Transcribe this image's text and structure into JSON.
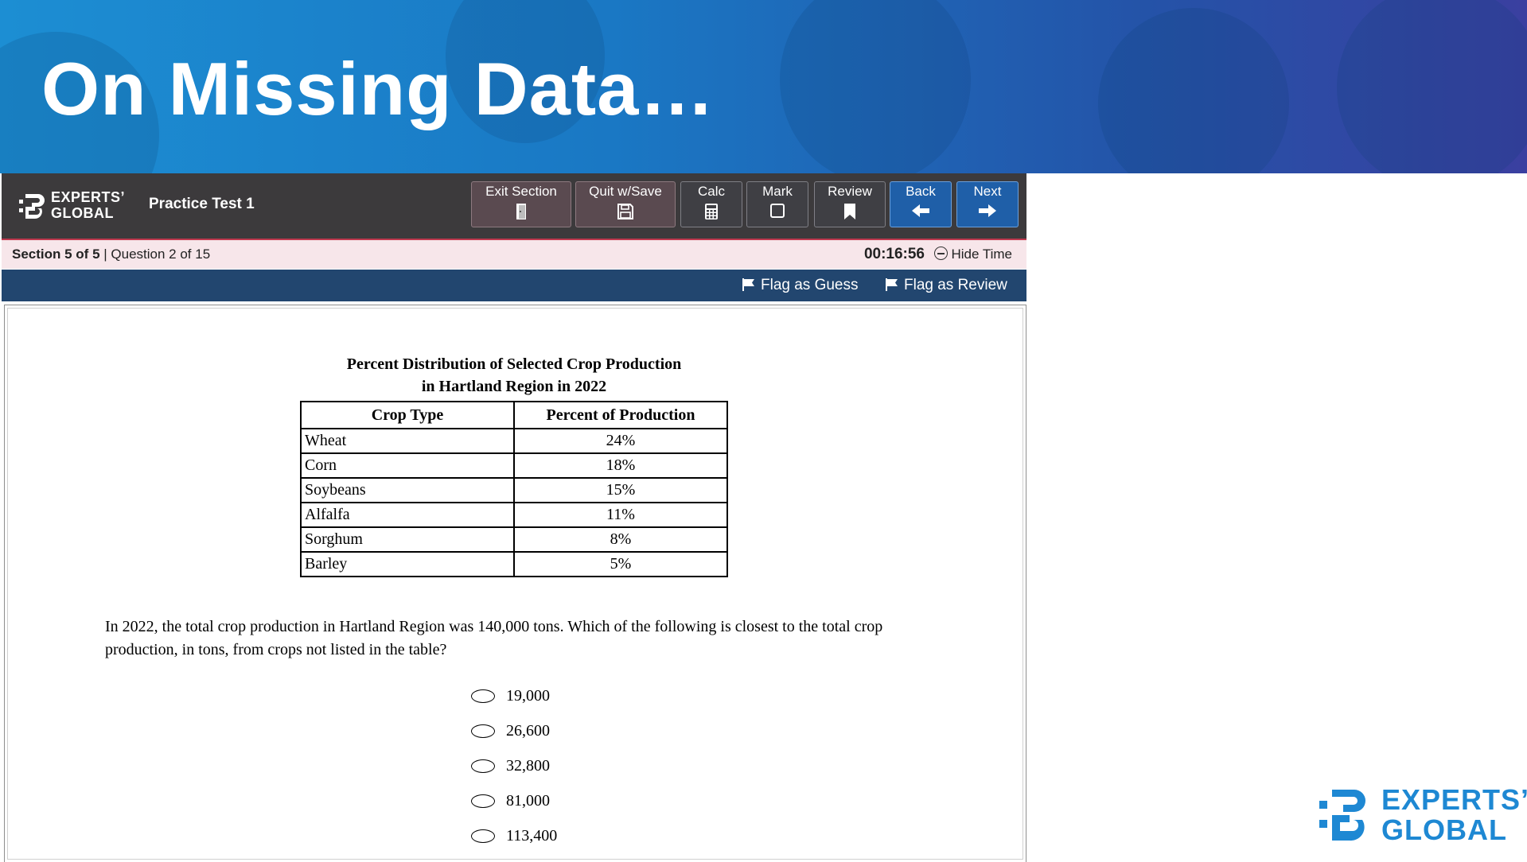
{
  "banner": {
    "title": "On Missing Data…"
  },
  "toolbar": {
    "logo_line1": "EXPERTS’",
    "logo_line2": "GLOBAL",
    "test_name": "Practice Test 1",
    "buttons": {
      "exit_section": "Exit Section",
      "quit_save": "Quit w/Save",
      "calc": "Calc",
      "mark": "Mark",
      "review": "Review",
      "back": "Back",
      "next": "Next"
    }
  },
  "infobar": {
    "section": "Section 5 of 5",
    "separator": " | ",
    "question": "Question 2 of 15",
    "timer": "00:16:56",
    "hide_time": "Hide Time"
  },
  "flagbar": {
    "flag_guess": "Flag as Guess",
    "flag_review": "Flag as Review"
  },
  "table": {
    "title_line1": "Percent Distribution of Selected Crop Production",
    "title_line2": "in Hartland Region in 2022",
    "headers": [
      "Crop Type",
      "Percent of Production"
    ],
    "rows": [
      [
        "Wheat",
        "24%"
      ],
      [
        "Corn",
        "18%"
      ],
      [
        "Soybeans",
        "15%"
      ],
      [
        "Alfalfa",
        "11%"
      ],
      [
        "Sorghum",
        "8%"
      ],
      [
        "Barley",
        "5%"
      ]
    ]
  },
  "question": {
    "text": "In 2022, the total crop production in Hartland Region was 140,000 tons. Which of the following is closest to the total crop production, in tons, from crops not listed in the table?",
    "choices": [
      "19,000",
      "26,600",
      "32,800",
      "81,000",
      "113,400"
    ]
  },
  "brand": {
    "line1": "EXPERTS’",
    "line2": "GLOBAL"
  },
  "colors": {
    "toolbar_bg": "#3c3a3c",
    "accent_line": "#c0394f",
    "info_bg": "#f7e6ea",
    "flagbar_bg": "#22466f",
    "nav_blue": "#1f5fa8",
    "brand_blue": "#1e88d3"
  }
}
